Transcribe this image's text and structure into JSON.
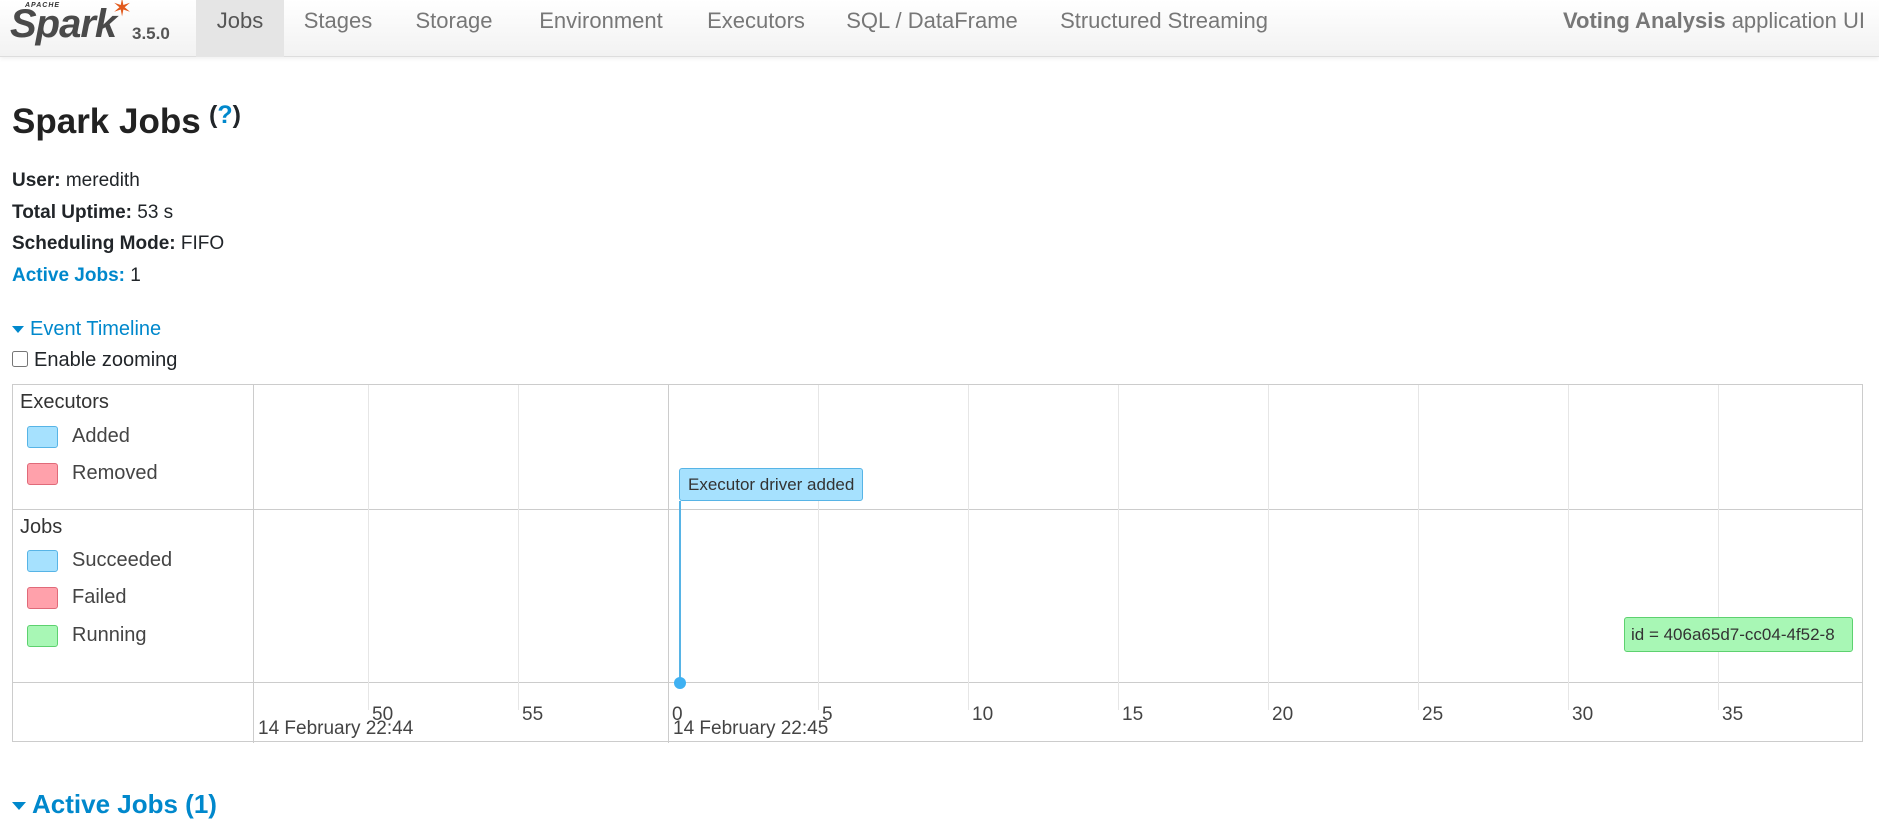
{
  "brand": {
    "apache": "APACHE",
    "name": "Spark",
    "version": "3.5.0"
  },
  "nav": {
    "tabs": [
      {
        "label": "Jobs",
        "active": true
      },
      {
        "label": "Stages",
        "active": false
      },
      {
        "label": "Storage",
        "active": false
      },
      {
        "label": "Environment",
        "active": false
      },
      {
        "label": "Executors",
        "active": false
      },
      {
        "label": "SQL / DataFrame",
        "active": false
      },
      {
        "label": "Structured Streaming",
        "active": false
      }
    ],
    "app_name": "Voting Analysis",
    "app_suffix": "application UI"
  },
  "page": {
    "title": "Spark Jobs",
    "help_open": "(",
    "help_mark": "?",
    "help_close": ")"
  },
  "summary": {
    "user_label": "User:",
    "user_value": "meredith",
    "uptime_label": "Total Uptime:",
    "uptime_value": "53 s",
    "scheduling_label": "Scheduling Mode:",
    "scheduling_value": "FIFO",
    "active_jobs_label": "Active Jobs:",
    "active_jobs_value": "1"
  },
  "timeline": {
    "toggle_label": "Event Timeline",
    "zoom_label": "Enable zooming",
    "zoom_checked": false,
    "executors_group": "Executors",
    "executors_legend": [
      "Added",
      "Removed"
    ],
    "jobs_group": "Jobs",
    "jobs_legend": [
      "Succeeded",
      "Failed",
      "Running"
    ],
    "minor_ticks": [
      "50",
      "55",
      "0",
      "5",
      "10",
      "15",
      "20",
      "25",
      "30",
      "35"
    ],
    "major_ticks": [
      "14 February 22:44",
      "14 February 22:45"
    ],
    "executor_event": "Executor driver added",
    "job_event": "id = 406a65d7-cc04-4f52-8",
    "colors": {
      "added": "#a6e1fe",
      "removed": "#ffa1ab",
      "running": "#a8f7b5",
      "link": "#0088cc"
    }
  },
  "active_jobs_section": {
    "label": "Active Jobs (1)"
  }
}
